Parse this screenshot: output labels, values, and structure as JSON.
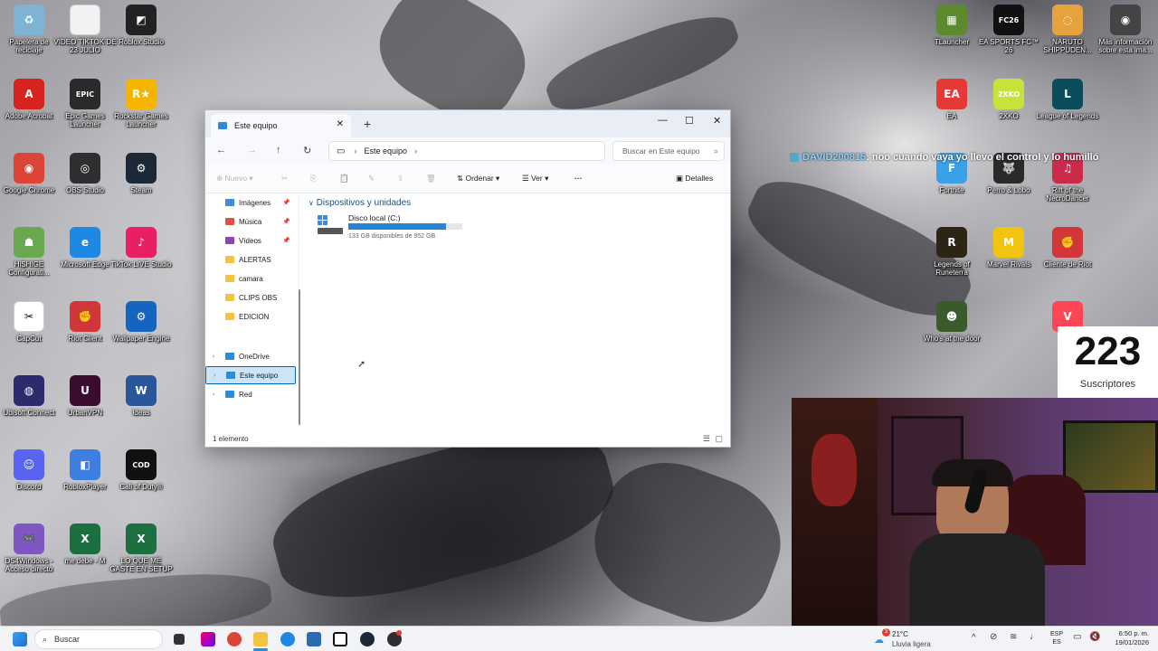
{
  "desktop_icons": [
    {
      "label": "Papelera de reciclaje",
      "icon": "recycle-bin-icon",
      "color": "#7fb3d5",
      "glyph": "♻"
    },
    {
      "label": "VIDEO TIKTOK DE 23 JULIO",
      "icon": "document-icon",
      "color": "#f2f2f2",
      "glyph": ""
    },
    {
      "label": "Roblox Studio",
      "icon": "roblox-studio-icon",
      "color": "#222222",
      "glyph": "◩"
    },
    {
      "label": "Adobe Acrobat",
      "icon": "acrobat-icon",
      "color": "#d7231f",
      "glyph": "A"
    },
    {
      "label": "Epic Games Launcher",
      "icon": "epic-games-icon",
      "color": "#2a2a2a",
      "glyph": "EPIC"
    },
    {
      "label": "Rockstar Games Launcher",
      "icon": "rockstar-icon",
      "color": "#f4b400",
      "glyph": "R★"
    },
    {
      "label": "Google Chrome",
      "icon": "chrome-icon",
      "color": "#db4437",
      "glyph": "◉"
    },
    {
      "label": "OBS Studio",
      "icon": "obs-icon",
      "color": "#302e31",
      "glyph": "◎"
    },
    {
      "label": "Steam",
      "icon": "steam-icon",
      "color": "#1b2838",
      "glyph": "⚙"
    },
    {
      "label": "HiSHIGE Configurati...",
      "icon": "hishige-icon",
      "color": "#6aa84f",
      "glyph": "☗"
    },
    {
      "label": "Microsoft Edge",
      "icon": "edge-icon",
      "color": "#1e88e5",
      "glyph": "e"
    },
    {
      "label": "TikTok LIVE Studio",
      "icon": "tiktok-icon",
      "color": "#e91e63",
      "glyph": "♪"
    },
    {
      "label": "CapCut",
      "icon": "capcut-icon",
      "color": "#ffffff",
      "glyph": "✂"
    },
    {
      "label": "Riot Client",
      "icon": "riot-client-icon",
      "color": "#d13639",
      "glyph": "✊"
    },
    {
      "label": "Wallpaper Engine",
      "icon": "wallpaper-engine-icon",
      "color": "#1565c0",
      "glyph": "⚙"
    },
    {
      "label": "Ubisoft Connect",
      "icon": "ubisoft-icon",
      "color": "#2b2b6e",
      "glyph": "◍"
    },
    {
      "label": "UrbanVPN",
      "icon": "urbanvpn-icon",
      "color": "#3a0d2e",
      "glyph": "U"
    },
    {
      "label": "Ideas",
      "icon": "word-icon",
      "color": "#2b579a",
      "glyph": "W"
    },
    {
      "label": "Discord",
      "icon": "discord-icon",
      "color": "#5865f2",
      "glyph": "☺"
    },
    {
      "label": "RobloxPlayer",
      "icon": "roblox-icon",
      "color": "#3d7fe0",
      "glyph": "◧"
    },
    {
      "label": "Call of Duty®",
      "icon": "call-of-duty-icon",
      "color": "#111111",
      "glyph": "COD"
    },
    {
      "label": "DS4Windows - Acceso directo",
      "icon": "ds4windows-icon",
      "color": "#7e57c2",
      "glyph": "🎮"
    },
    {
      "label": "me debe - M",
      "icon": "excel-icon",
      "color": "#1d6f42",
      "glyph": "X"
    },
    {
      "label": "LO QUE ME GASTE EN SETUP",
      "icon": "excel-icon",
      "color": "#1d6f42",
      "glyph": "X"
    },
    {
      "label": "TLauncher",
      "icon": "tlauncher-icon",
      "color": "#5d8a2e",
      "glyph": "▦"
    },
    {
      "label": "EA SPORTS FC™ 26",
      "icon": "fc26-icon",
      "color": "#111111",
      "glyph": "FC26"
    },
    {
      "label": "NARUTO SHIPPUDEN...",
      "icon": "naruto-icon",
      "color": "#e6a23c",
      "glyph": "◌"
    },
    {
      "label": "Más información sobre esta ima...",
      "icon": "info-camera-icon",
      "color": "#444444",
      "glyph": "◉"
    },
    {
      "label": "EA",
      "icon": "ea-icon",
      "color": "#e53935",
      "glyph": "EA"
    },
    {
      "label": "2XKO",
      "icon": "2xko-icon",
      "color": "#c6e33b",
      "glyph": "2XKO"
    },
    {
      "label": "League of Legends",
      "icon": "league-icon",
      "color": "#0a4b5c",
      "glyph": "L"
    },
    {
      "label": "Fortnite",
      "icon": "fortnite-icon",
      "color": "#3aa0e8",
      "glyph": "F"
    },
    {
      "label": "Perro & Lobo",
      "icon": "perro-lobo-icon",
      "color": "#2a2a2a",
      "glyph": "🐺"
    },
    {
      "label": "Rift of the NecroDancer",
      "icon": "rift-icon",
      "color": "#cc2a4a",
      "glyph": "♫"
    },
    {
      "label": "Legends of Runeterra",
      "icon": "runeterra-icon",
      "color": "#2d2416",
      "glyph": "R"
    },
    {
      "label": "Marvel Rivals",
      "icon": "marvel-rivals-icon",
      "color": "#f1c40f",
      "glyph": "M"
    },
    {
      "label": "Cliente de Riot",
      "icon": "riot-client-icon",
      "color": "#d13639",
      "glyph": "✊"
    },
    {
      "label": "Who's at the door",
      "icon": "whos-door-icon",
      "color": "#3a5a2a",
      "glyph": "☻"
    },
    {
      "label": "V",
      "icon": "valorant-icon",
      "color": "#ff4655",
      "glyph": "V"
    }
  ],
  "explorer": {
    "tab_title": "Este equipo",
    "close_tab": "✕",
    "new_tab": "+",
    "minimize": "—",
    "maximize": "☐",
    "close": "✕",
    "breadcrumb": "Este equipo",
    "breadcrumb_sep": "›",
    "search_placeholder": "Buscar en Este equipo",
    "toolbar": {
      "new": "Nuevo",
      "sort": "Ordenar",
      "view": "Ver",
      "more": "···",
      "details": "Detalles"
    },
    "sidebar": [
      {
        "label": "Imágenes",
        "color": "#3c8edb",
        "pinned": true
      },
      {
        "label": "Música",
        "color": "#e0533d",
        "pinned": true
      },
      {
        "label": "Vídeos",
        "color": "#8e44ad",
        "pinned": true
      },
      {
        "label": "ALERTAS",
        "color": "#f5c242",
        "pinned": false
      },
      {
        "label": "camara",
        "color": "#f5c242",
        "pinned": false
      },
      {
        "label": "CLIPS OBS",
        "color": "#f5c242",
        "pinned": false
      },
      {
        "label": "EDICION",
        "color": "#f5c242",
        "pinned": false
      }
    ],
    "sidebar_tree": [
      {
        "label": "OneDrive",
        "color": "#2f8ad8",
        "selected": false
      },
      {
        "label": "Este equipo",
        "color": "#2f8ad8",
        "selected": true
      },
      {
        "label": "Red",
        "color": "#2f8ad8",
        "selected": false
      }
    ],
    "section": "Dispositivos y unidades",
    "drive": {
      "name": "Disco local (C:)",
      "free": "133 GB disponibles de 952 GB",
      "used_fraction": 0.86
    },
    "status": "1 elemento"
  },
  "overlay": {
    "chat_user": "DAVID200815",
    "chat_text": ": noo cuando vaya yo llevo el control y lo humilló",
    "subs_count": "223",
    "subs_label": "Suscriptores"
  },
  "taskbar": {
    "search": "Buscar",
    "weather_temp": "21°C",
    "weather_desc": "Lluvia ligera",
    "weather_badge": "3",
    "lang1": "ESP",
    "lang2": "ES",
    "time": "6:50 p. m.",
    "date": "19/01/2026"
  }
}
